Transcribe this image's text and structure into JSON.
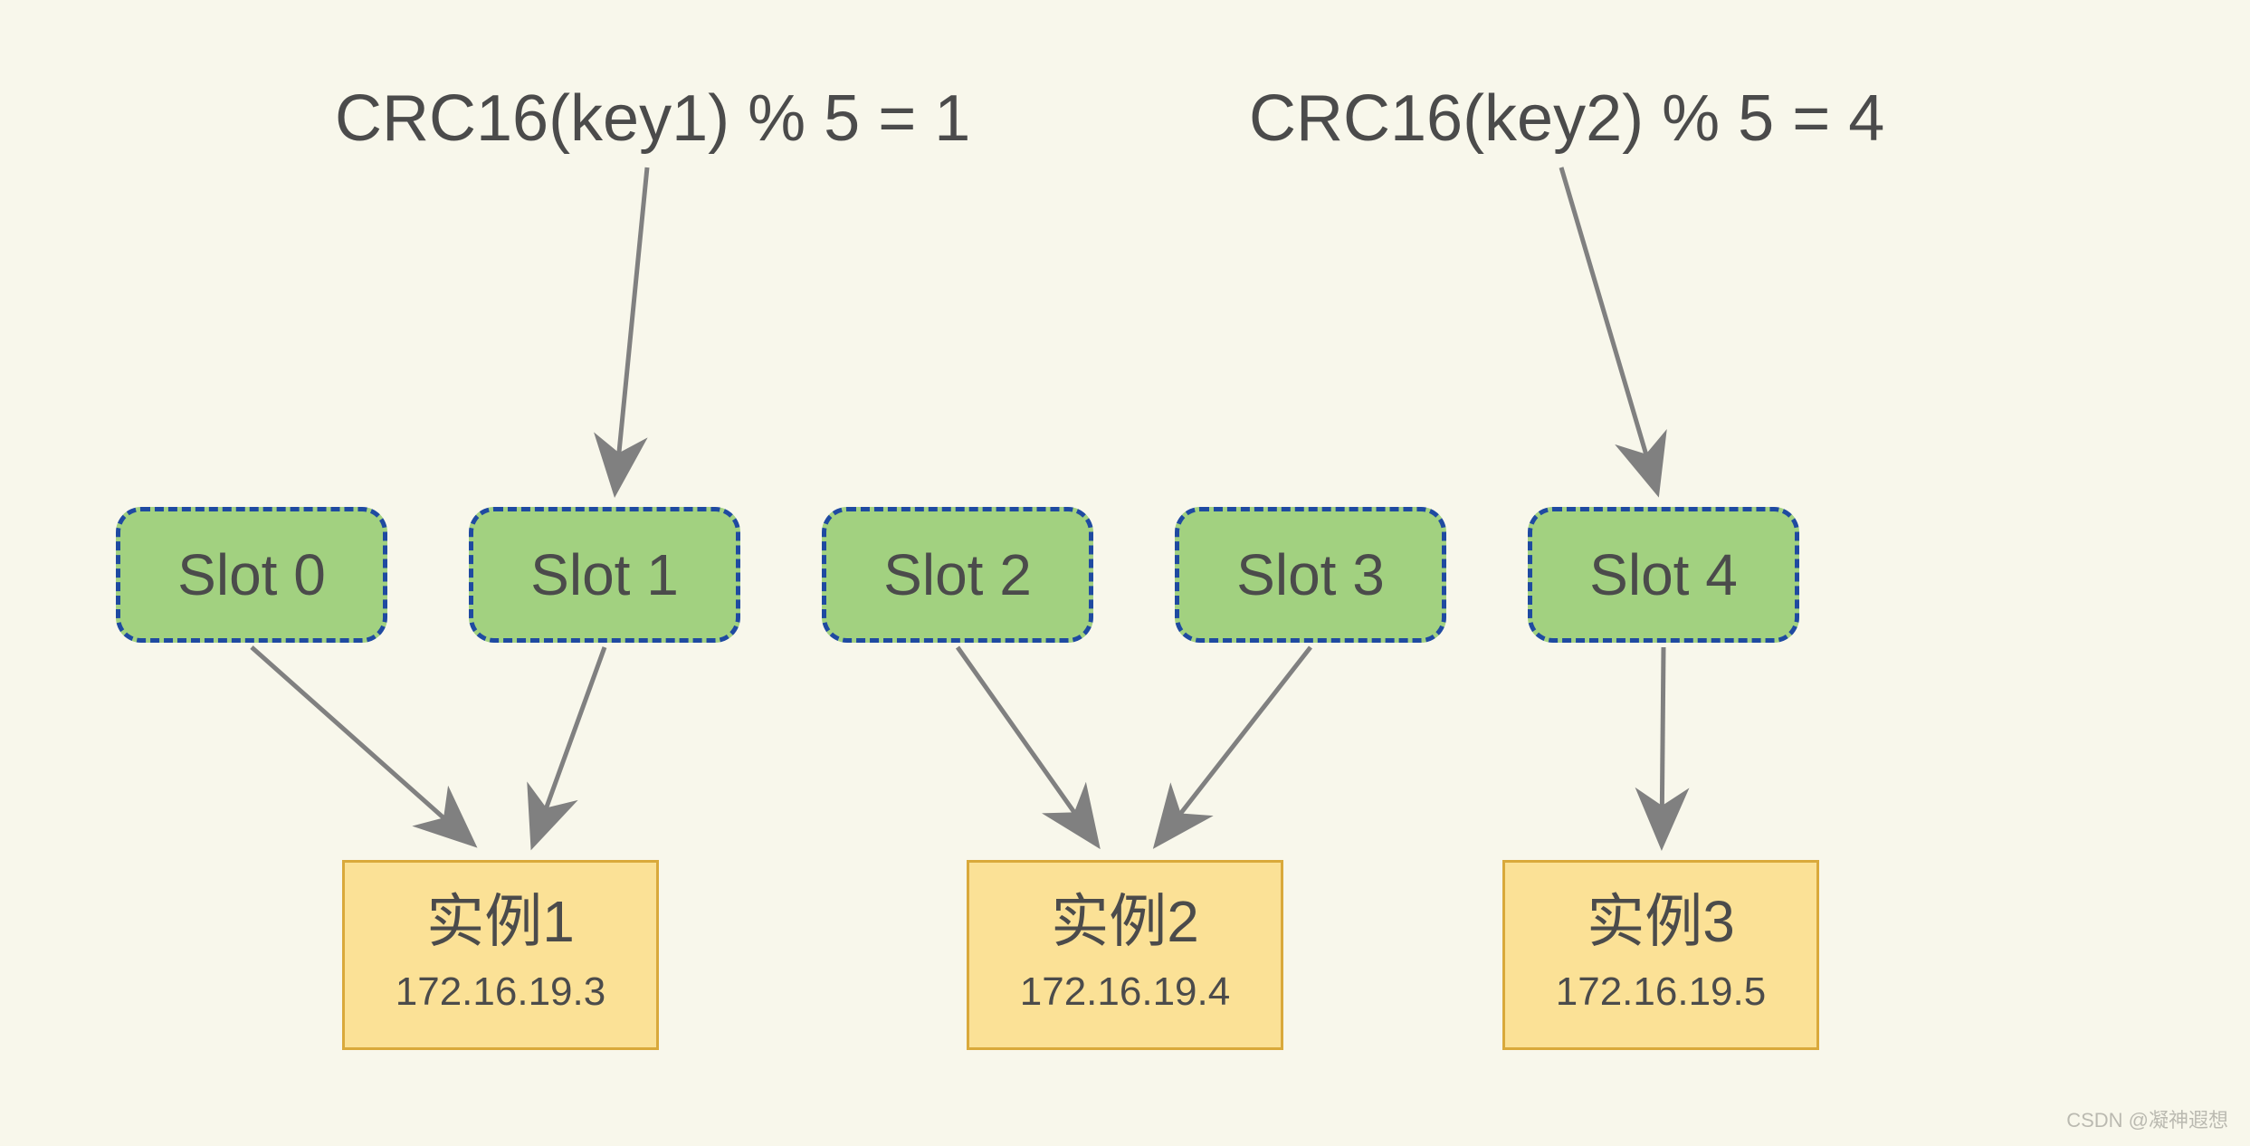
{
  "formulas": [
    {
      "text": "CRC16(key1) %  5 = 1",
      "target_slot": 1
    },
    {
      "text": "CRC16(key2) %  5 = 4",
      "target_slot": 4
    }
  ],
  "slots": [
    {
      "label": "Slot 0",
      "instance": 0
    },
    {
      "label": "Slot 1",
      "instance": 0
    },
    {
      "label": "Slot 2",
      "instance": 1
    },
    {
      "label": "Slot 3",
      "instance": 1
    },
    {
      "label": "Slot 4",
      "instance": 2
    }
  ],
  "instances": [
    {
      "title": "实例1",
      "ip": "172.16.19.3"
    },
    {
      "title": "实例2",
      "ip": "172.16.19.4"
    },
    {
      "title": "实例3",
      "ip": "172.16.19.5"
    }
  ],
  "watermark": "CSDN @凝神遐想",
  "colors": {
    "bg": "#f8f7eb",
    "slot_fill": "#a2d180",
    "slot_border": "#1f4aa1",
    "instance_fill": "#fbe196",
    "instance_border": "#d9a93b",
    "arrow": "#808080",
    "text": "#4b4b4b"
  },
  "chart_data": {
    "type": "table",
    "description": "Hash-slot to instance mapping diagram",
    "hash_function": "CRC16(key) % 5",
    "examples": [
      {
        "key": "key1",
        "slot": 1
      },
      {
        "key": "key2",
        "slot": 4
      }
    ],
    "slot_assignment": [
      {
        "slot": 0,
        "instance": "实例1",
        "ip": "172.16.19.3"
      },
      {
        "slot": 1,
        "instance": "实例1",
        "ip": "172.16.19.3"
      },
      {
        "slot": 2,
        "instance": "实例2",
        "ip": "172.16.19.4"
      },
      {
        "slot": 3,
        "instance": "实例2",
        "ip": "172.16.19.4"
      },
      {
        "slot": 4,
        "instance": "实例3",
        "ip": "172.16.19.5"
      }
    ]
  }
}
